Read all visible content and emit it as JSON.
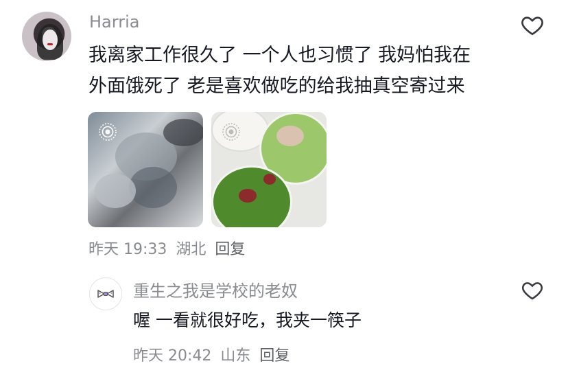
{
  "comment": {
    "username": "Harria",
    "text_line1": "我离家工作很久了 一个人也习惯了 我妈怕我在",
    "text_line2": "外面饿死了 老是喜欢做吃的给我抽真空寄过来",
    "time": "昨天 19:33",
    "location": "湖北",
    "reply_label": "回复",
    "icons": {
      "like": "heart-outline-icon",
      "live_photo": "live-photo-icon"
    }
  },
  "reply": {
    "username": "重生之我是学校的老奴",
    "text": "喔 一看就很好吃，我夹一筷子",
    "time": "昨天 20:42",
    "location": "山东",
    "reply_label": "回复",
    "icons": {
      "like": "heart-outline-icon",
      "avatar": "bow-icon"
    }
  },
  "colors": {
    "text_primary": "#161823",
    "text_secondary": "#8a8b91",
    "background": "#ffffff"
  }
}
